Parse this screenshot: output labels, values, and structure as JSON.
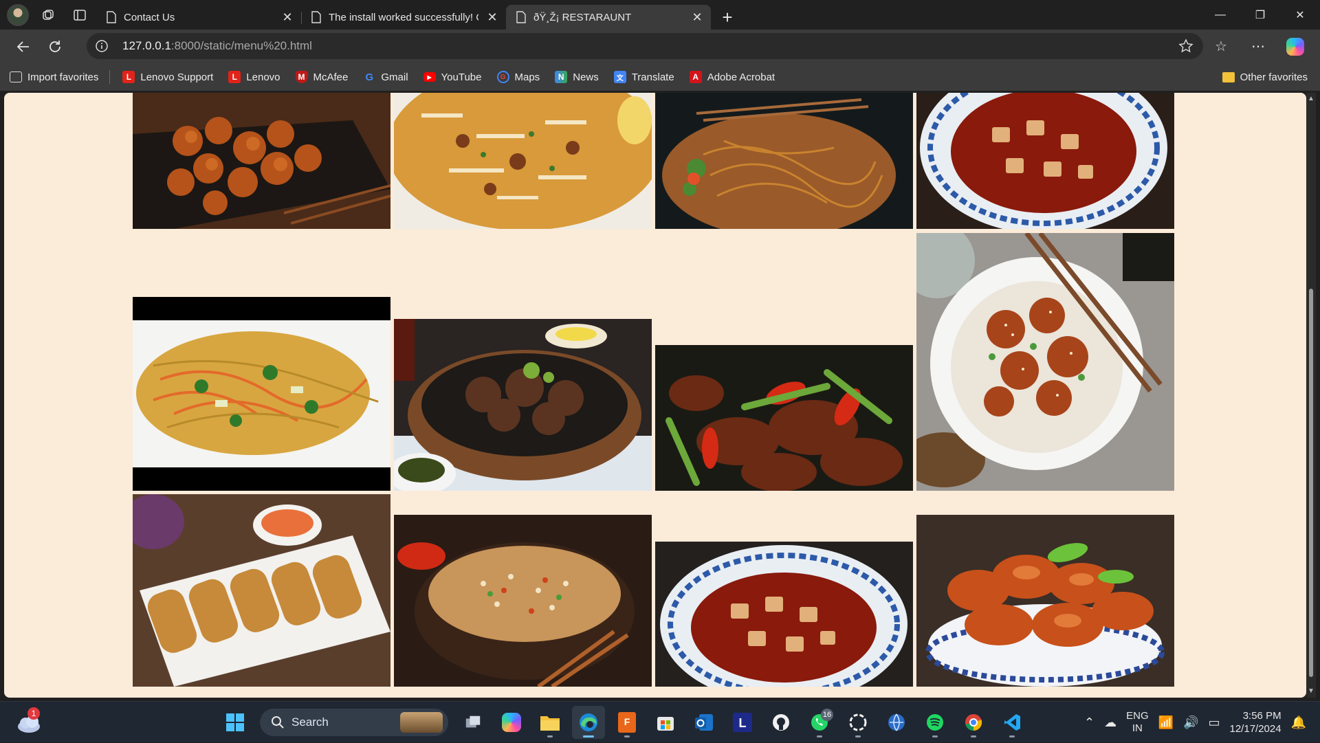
{
  "tabs": [
    {
      "title": "Contact Us",
      "active": false
    },
    {
      "title": "The install worked successfully! Co",
      "active": false
    },
    {
      "title": "ðŸ¸Ž¡ RESTARAUNT",
      "active": true
    }
  ],
  "address": {
    "host": "127.0.0.1",
    "rest": ":8000/static/menu%20.html"
  },
  "favorites": [
    {
      "label": "Import favorites",
      "icon": "import-icon"
    },
    {
      "label": "Lenovo Support",
      "icon": "lenovo-icon"
    },
    {
      "label": "Lenovo",
      "icon": "lenovo-icon"
    },
    {
      "label": "McAfee",
      "icon": "mcafee-icon"
    },
    {
      "label": "Gmail",
      "icon": "google-icon"
    },
    {
      "label": "YouTube",
      "icon": "youtube-icon"
    },
    {
      "label": "Maps",
      "icon": "google-icon"
    },
    {
      "label": "News",
      "icon": "news-icon"
    },
    {
      "label": "Translate",
      "icon": "translate-icon"
    },
    {
      "label": "Adobe Acrobat",
      "icon": "acrobat-icon"
    }
  ],
  "other_favorites": "Other favorites",
  "menu_images": [
    "orange-chicken",
    "chicken-biryani",
    "stir-fried-noodles",
    "mapo-tofu",
    "vegetable-hakka-noodles",
    "sizzling-beef",
    "chilli-pork",
    "sesame-chicken-rice",
    "spring-rolls",
    "fried-rice",
    "mapo-tofu",
    "crayfish-bowl"
  ],
  "taskbar": {
    "search_label": "Search",
    "weather_badge": "1",
    "whatsapp_count": "16",
    "lang_line1": "ENG",
    "lang_line2": "IN",
    "time": "3:56 PM",
    "date": "12/17/2024"
  },
  "colors": {
    "page_bg": "#fbebd9",
    "chrome_dark": "#202020",
    "chrome": "#3b3b3b",
    "taskbar": "#1f2732"
  }
}
